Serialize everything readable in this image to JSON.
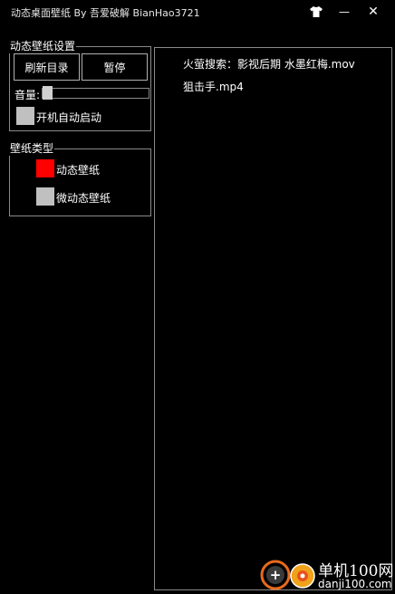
{
  "window": {
    "title": "动态桌面壁纸 By 吾爱破解 BianHao3721",
    "minimize_symbol": "—",
    "close_symbol": "✕"
  },
  "settings_group": {
    "label": "动态壁纸设置",
    "refresh_button": "刷新目录",
    "pause_button": "暂停",
    "volume_label": "音量:",
    "volume_level": 0,
    "autostart_label": "开机自动启动",
    "autostart_checked": false
  },
  "type_group": {
    "label": "壁纸类型",
    "options": [
      {
        "label": "动态壁纸",
        "selected": true,
        "color": "#ff0000"
      },
      {
        "label": "微动态壁纸",
        "selected": false,
        "color": "#c0c0c0"
      }
    ]
  },
  "file_list": [
    "火萤搜索：影视后期  水墨红梅.mov",
    "狙击手.mp4"
  ],
  "watermark": {
    "text_cn": "单机100网",
    "text_url": "danji100.com"
  },
  "colors": {
    "background": "#000000",
    "border": "#8a8a8a",
    "selected": "#ff0000",
    "unselected": "#c0c0c0"
  }
}
